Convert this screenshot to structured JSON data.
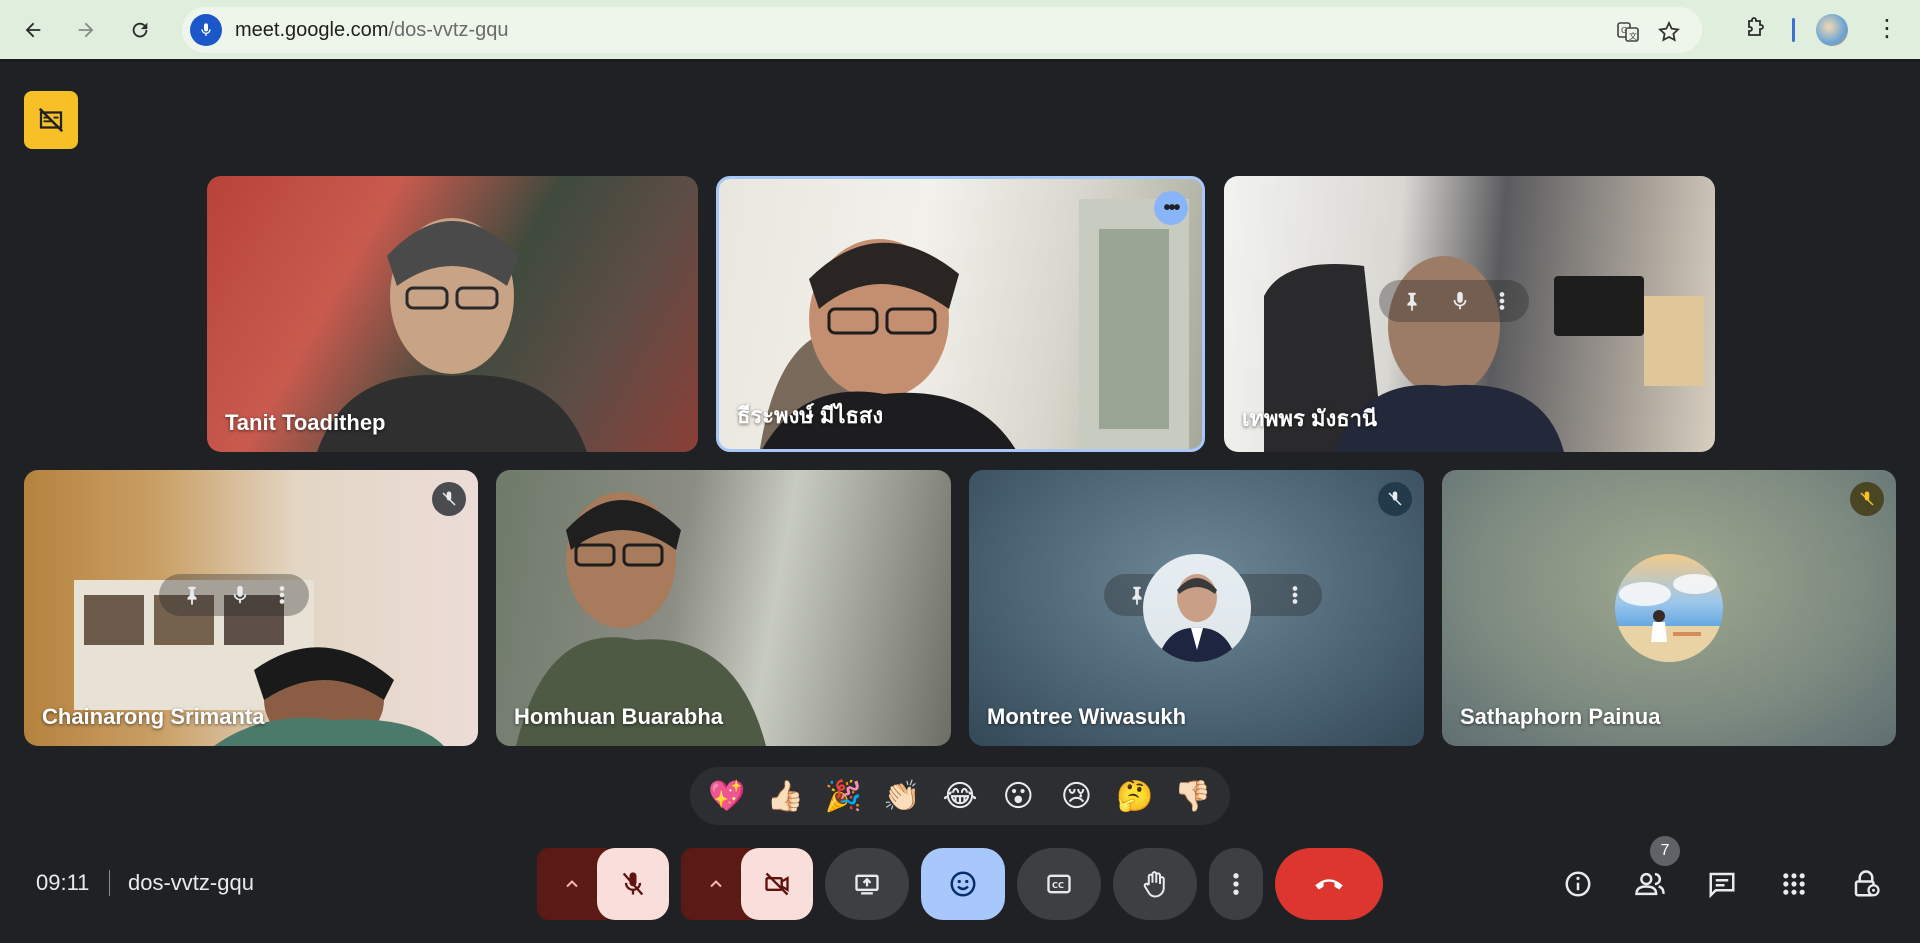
{
  "browser": {
    "url_domain": "meet.google.com",
    "url_path": "/dos-vvtz-gqu",
    "back_icon": "back-arrow-icon",
    "forward_icon": "forward-arrow-icon",
    "reload_icon": "reload-icon"
  },
  "tiles": [
    {
      "name": "Tanit Toadithep"
    },
    {
      "name": "ธีระพงษ์ มีไธสง"
    },
    {
      "name": "เทพพร มังธานี"
    },
    {
      "name": "Chainarong Srimanta"
    },
    {
      "name": "Homhuan Buarabha"
    },
    {
      "name": "Montree Wiwasukh"
    },
    {
      "name": "Sathaphorn Painua"
    }
  ],
  "reactions": [
    "💖",
    "👍🏻",
    "🎉",
    "👏🏻",
    "😂",
    "😮",
    "😢",
    "🤔",
    "👎🏻"
  ],
  "footer": {
    "time": "09:11",
    "meeting_code": "dos-vvtz-gqu",
    "participant_count": "7"
  },
  "colors": {
    "accent_blue": "#a8c7fa",
    "end_call_red": "#dc362e",
    "effects_yellow": "#f6c026"
  }
}
